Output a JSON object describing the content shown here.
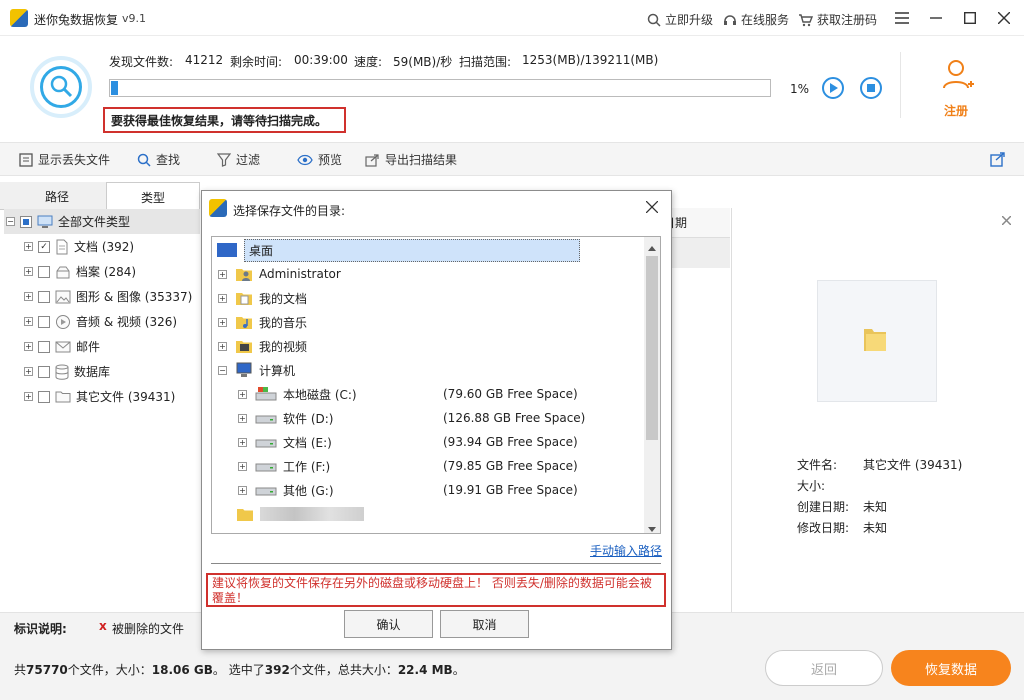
{
  "app": {
    "title": "迷你兔数据恢复",
    "version": "v9.1"
  },
  "header_links": [
    {
      "label": "立即升级",
      "icon": "upgrade-icon"
    },
    {
      "label": "在线服务",
      "icon": "headset-icon"
    },
    {
      "label": "获取注册码",
      "icon": "cart-icon"
    }
  ],
  "scan": {
    "found_label": "发现文件数:",
    "found_value": "41212",
    "remaining_label": "剩余时间:",
    "remaining_value": "00:39:00",
    "speed_label": "速度:",
    "speed_value": "59(MB)/秒",
    "range_label": "扫描范围:",
    "range_value": "1253(MB)/139211(MB)",
    "progress_percent": 1,
    "progress_text": "1%",
    "warning": "要获得最佳恢复结果，请等待扫描完成。"
  },
  "register": {
    "label": "注册"
  },
  "toolbar": [
    {
      "label": "显示丢失文件",
      "icon": "show-lost-icon"
    },
    {
      "label": "查找",
      "icon": "search-icon"
    },
    {
      "label": "过滤",
      "icon": "filter-icon"
    },
    {
      "label": "预览",
      "icon": "eye-icon"
    },
    {
      "label": "导出扫描结果",
      "icon": "export-icon"
    }
  ],
  "tabs": {
    "path": "路径",
    "type": "类型"
  },
  "tree": [
    {
      "label": "全部文件类型",
      "check": "partial"
    },
    {
      "label": "文档 (392)",
      "check": "checked"
    },
    {
      "label": "档案 (284)",
      "check": "none"
    },
    {
      "label": "图形 & 图像 (35337)",
      "check": "none"
    },
    {
      "label": "音频 & 视频 (326)",
      "check": "none"
    },
    {
      "label": "邮件",
      "check": "none"
    },
    {
      "label": "数据库",
      "check": "none"
    },
    {
      "label": "其它文件 (39431)",
      "check": "none"
    }
  ],
  "mid": {
    "header_fragment": "日期"
  },
  "details": {
    "name_label": "文件名:",
    "name_value": "其它文件 (39431)",
    "size_label": "大小:",
    "created_label": "创建日期:",
    "created_value": "未知",
    "modified_label": "修改日期:",
    "modified_value": "未知"
  },
  "legend": {
    "label": "标识说明:",
    "mark": "x",
    "text": "被删除的文件"
  },
  "summary": {
    "text_prefix": "共",
    "total_files": "75770",
    "mid1": "个文件，大小：",
    "total_size": "18.06 GB",
    "mid2": "。 选中了",
    "selected_files": "392",
    "mid3": "个文件，总共大小：",
    "selected_size": "22.4 MB",
    "end": "。"
  },
  "buttons": {
    "back": "返回",
    "recover": "恢复数据"
  },
  "dialog": {
    "title": "选择保存文件的目录:",
    "tree": [
      {
        "label": "桌面",
        "level": 0,
        "expander": false,
        "icon": "desktop-icon",
        "selected": true
      },
      {
        "label": "Administrator",
        "level": 1,
        "expander": true,
        "icon": "user-folder-icon"
      },
      {
        "label": "我的文档",
        "level": 1,
        "expander": true,
        "icon": "documents-folder-icon"
      },
      {
        "label": "我的音乐",
        "level": 1,
        "expander": true,
        "icon": "music-folder-icon"
      },
      {
        "label": "我的视频",
        "level": 1,
        "expander": true,
        "icon": "video-folder-icon"
      },
      {
        "label": "计算机",
        "level": 1,
        "expander": true,
        "icon": "computer-icon"
      },
      {
        "label": "本地磁盘 (C:)",
        "level": 2,
        "expander": true,
        "icon": "system-drive-icon",
        "free": "(79.60 GB Free Space)"
      },
      {
        "label": "软件 (D:)",
        "level": 2,
        "expander": true,
        "icon": "drive-icon",
        "free": "(126.88 GB Free Space)"
      },
      {
        "label": "文档 (E:)",
        "level": 2,
        "expander": true,
        "icon": "drive-icon",
        "free": "(93.94 GB Free Space)"
      },
      {
        "label": "工作 (F:)",
        "level": 2,
        "expander": true,
        "icon": "drive-icon",
        "free": "(79.85 GB Free Space)"
      },
      {
        "label": "其他 (G:)",
        "level": 2,
        "expander": true,
        "icon": "drive-icon",
        "free": "(19.91 GB Free Space)"
      }
    ],
    "manual_link": "手动输入路径",
    "warning": "建议将恢复的文件保存在另外的磁盘或移动硬盘上！ 否则丢失/删除的数据可能会被覆盖！",
    "ok": "确认",
    "cancel": "取消"
  }
}
